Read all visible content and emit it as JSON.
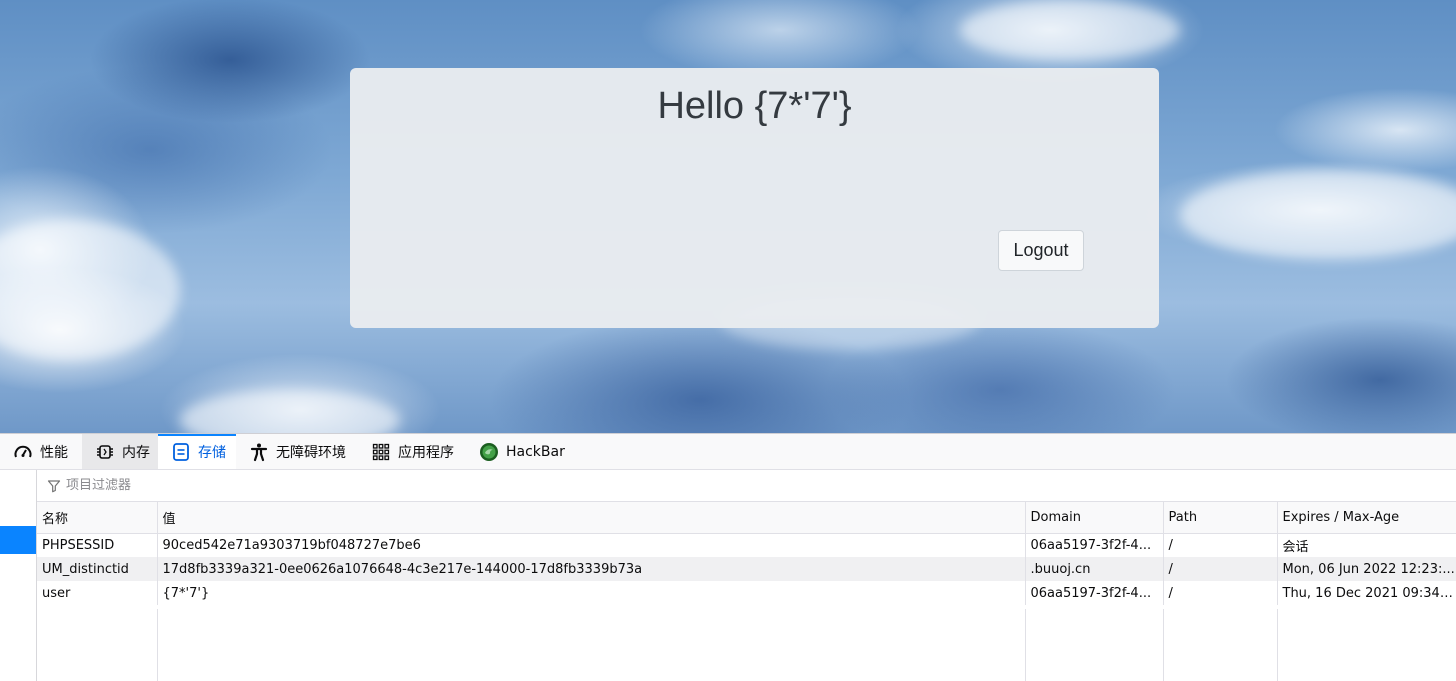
{
  "page": {
    "greeting": "Hello {7*'7'}",
    "logout_label": "Logout"
  },
  "devtools": {
    "tabs": [
      {
        "label": "性能",
        "icon": "performance-gauge-icon"
      },
      {
        "label": "内存",
        "icon": "memory-chip-icon"
      },
      {
        "label": "存储",
        "icon": "storage-icon",
        "active": true
      },
      {
        "label": "无障碍环境",
        "icon": "accessibility-icon"
      },
      {
        "label": "应用程序",
        "icon": "application-grid-icon"
      },
      {
        "label": "HackBar",
        "icon": "hackbar-icon"
      }
    ],
    "filter_placeholder": "项目过滤器",
    "columns": [
      "名称",
      "值",
      "Domain",
      "Path",
      "Expires / Max-Age"
    ],
    "rows": [
      {
        "name": "PHPSESSID",
        "value": "90ced542e71a9303719bf048727e7be6",
        "domain": "06aa5197-3f2f-4...",
        "path": "/",
        "expires": "会话"
      },
      {
        "name": "UM_distinctid",
        "value": "17d8fb3339a321-0ee0626a1076648-4c3e217e-144000-17d8fb3339b73a",
        "domain": ".buuoj.cn",
        "path": "/",
        "expires": "Mon, 06 Jun 2022 12:23:..."
      },
      {
        "name": "user",
        "value": "{7*'7'}",
        "domain": "06aa5197-3f2f-4...",
        "path": "/",
        "expires": "Thu, 16 Dec 2021 09:34:..."
      }
    ],
    "colors": {
      "accent": "#0a84ff",
      "active_tab_text": "#0060df",
      "hackbar_green": "#2e7d32"
    }
  }
}
